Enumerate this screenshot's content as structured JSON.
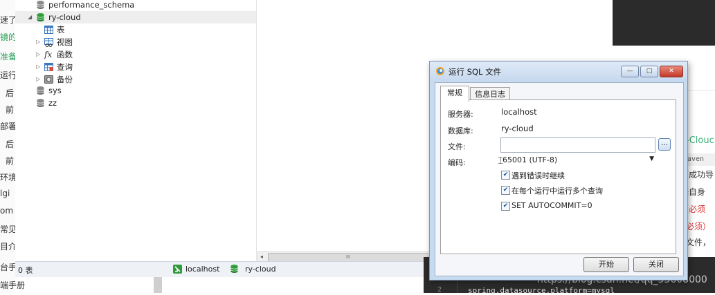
{
  "left_doc": {
    "lines": [
      "速了",
      "镜的",
      "准备",
      "运行",
      "后",
      "前",
      "部署",
      "后",
      "前",
      "环境",
      "lgi",
      "om",
      "常见",
      "目介",
      "台手",
      "端手册"
    ]
  },
  "tree": {
    "nodes": [
      {
        "label": "performance_schema",
        "icon": "database-icon"
      },
      {
        "label": "ry-cloud",
        "icon": "database-icon"
      },
      {
        "label": "表",
        "icon": "table-icon"
      },
      {
        "label": "视图",
        "icon": "view-icon"
      },
      {
        "label": "函数",
        "icon": "function-icon"
      },
      {
        "label": "查询",
        "icon": "query-icon"
      },
      {
        "label": "备份",
        "icon": "backup-icon"
      },
      {
        "label": "sys",
        "icon": "database-icon"
      },
      {
        "label": "zz",
        "icon": "database-icon"
      }
    ]
  },
  "statusbar": {
    "count": "0 表",
    "connection": "localhost",
    "database": "ry-cloud"
  },
  "hscroll": {
    "mid": "III"
  },
  "dialog": {
    "title": "运行 SQL 文件",
    "tabs": [
      "常规",
      "信息日志"
    ],
    "server_label": "服务器:",
    "server_value": "localhost",
    "database_label": "数据库:",
    "database_value": "ry-cloud",
    "file_label": "文件:",
    "file_value": "",
    "browse_label": "...",
    "encoding_label": "编码:",
    "encoding_value": "65001 (UTF-8)",
    "options": [
      {
        "label": "遇到错误时继续",
        "checked": true
      },
      {
        "label": "在每个运行中运行多个查询",
        "checked": true
      },
      {
        "label": "SET AUTOCOMMIT=0",
        "checked": true
      }
    ],
    "start_button": "开始",
    "close_button": "关闭",
    "window_buttons": [
      "—",
      "□",
      "✕"
    ]
  },
  "right_doc": {
    "heading": "-Clouc",
    "code_chip": "aven",
    "lines": [
      "可成功导",
      "据自身",
      "（必须",
      "必须）",
      "文件，"
    ]
  },
  "right_code": {
    "line_numbers": [
      "2"
    ],
    "code": "spring.datasource.platform=mysql"
  },
  "watermark": "https://blog.csdn.net/qq_33608000",
  "colors": {
    "db_green": "#2e9a3a",
    "red_text": "#e03030",
    "heading_green": "#3bb37a"
  }
}
